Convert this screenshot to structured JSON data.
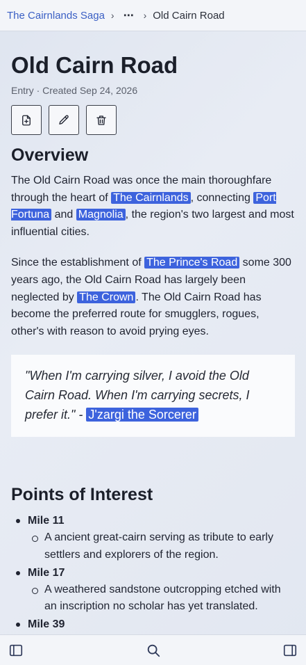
{
  "breadcrumb": {
    "root": "The Cairnlands Saga",
    "more": "⋯",
    "current": "Old Cairn Road",
    "separator": "›"
  },
  "page": {
    "title": "Old Cairn Road",
    "meta": "Entry · Created Sep 24, 2026"
  },
  "actions": {
    "new_icon": "file-plus-icon",
    "edit_icon": "pencil-icon",
    "delete_icon": "trash-icon"
  },
  "overview": {
    "heading": "Overview",
    "p1": {
      "t1": "The Old Cairn Road was once the main thoroughfare through the heart of ",
      "link1": "The Cairnlands",
      "t2": ", connecting ",
      "link2": "Port Fortuna",
      "t3": " and ",
      "link3": "Magnolia",
      "t4": ", the region's two largest and most influential cities."
    },
    "p2": {
      "t1": "Since the establishment of ",
      "link1": "The Prince's Road",
      "t2": " some 300 years ago, the Old Cairn Road has largely been neglected by ",
      "link2": "The Crown",
      "t3": ". The Old Cairn Road has become the preferred route for smugglers, rogues, other's with reason to avoid prying eyes."
    }
  },
  "quote": {
    "text": "\"When I'm carrying silver, I avoid the Old Cairn Road. When I'm carrying secrets, I prefer it.\" - ",
    "author": "J'zargi the Sorcerer"
  },
  "points_of_interest": {
    "heading": "Points of Interest",
    "items": [
      {
        "mile": "Mile 11",
        "description": "A ancient great-cairn serving as tribute to early settlers and explorers of the region."
      },
      {
        "mile": "Mile 17",
        "description": "A weathered sandstone outcropping etched with an inscription no scholar has yet translated."
      },
      {
        "mile": "Mile 39",
        "description": ""
      }
    ]
  },
  "bottom_bar": {
    "left_icon": "sidebar-left-icon",
    "center_icon": "search-icon",
    "right_icon": "sidebar-right-icon"
  },
  "colors": {
    "link_bg": "#3d63dd",
    "breadcrumb_link": "#3a5fc4",
    "page_bg": "#e2e7f1"
  }
}
